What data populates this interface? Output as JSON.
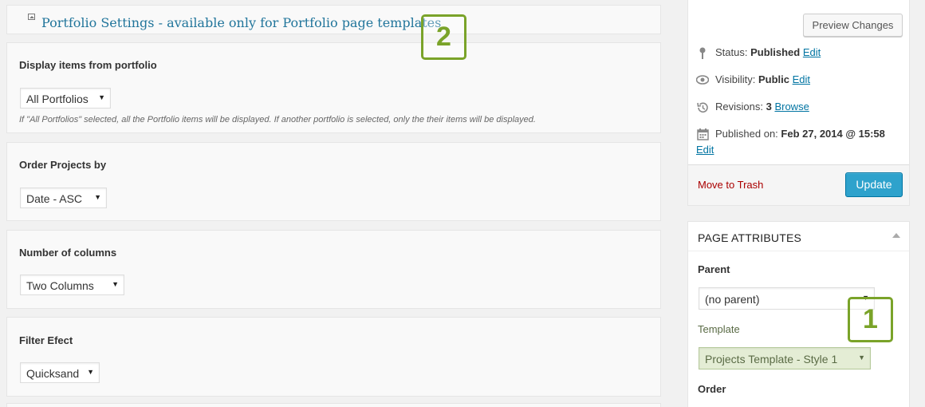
{
  "portfolio_settings": {
    "title": "Portfolio Settings - available only for Portfolio page templates",
    "sections": [
      {
        "label": "Display items from portfolio",
        "value": "All Portfolios",
        "help": "If \"All Portfolios\" selected, all the Portfolio items will be displayed. If another portfolio is selected, only the their items will be displayed."
      },
      {
        "label": "Order Projects by",
        "value": "Date - ASC"
      },
      {
        "label": "Number of columns",
        "value": "Two Columns"
      },
      {
        "label": "Filter Efect",
        "value": "Quicksand"
      }
    ]
  },
  "annotations": {
    "badge_left": "2",
    "badge_right": "1",
    "accent_color": "#7aa329"
  },
  "publish": {
    "preview_label": "Preview Changes",
    "status_label": "Status:",
    "status_value": "Published",
    "visibility_label": "Visibility:",
    "visibility_value": "Public",
    "revisions_label": "Revisions:",
    "revisions_value": "3",
    "browse_label": "Browse",
    "published_on_label": "Published on:",
    "published_on_value": "Feb 27, 2014 @ 15:58",
    "edit_label": "Edit",
    "trash_label": "Move to Trash",
    "update_label": "Update",
    "update_color": "#2ea2cc"
  },
  "page_attributes": {
    "title": "PAGE ATTRIBUTES",
    "parent_label": "Parent",
    "parent_value": "(no parent)",
    "template_label": "Template",
    "template_value": "Projects Template - Style 1",
    "order_label": "Order"
  },
  "icons": {
    "header": "image-icon",
    "status": "pin-icon",
    "visibility": "eye-icon",
    "revisions": "history-icon",
    "published_on": "calendar-icon",
    "select_arrow": "triangle-down-icon",
    "collapse": "triangle-up-icon"
  }
}
